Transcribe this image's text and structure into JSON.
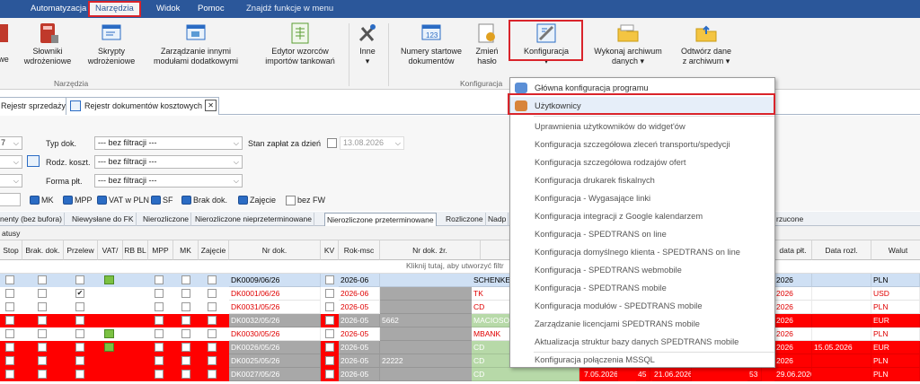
{
  "menubar": {
    "items": [
      {
        "label": "Automatyzacja"
      },
      {
        "label": "Narzędzia"
      },
      {
        "label": "Widok"
      },
      {
        "label": "Pomoc"
      }
    ],
    "search": "Znajdź funkcje w menu"
  },
  "ribbon": {
    "buttons": [
      {
        "label": "we",
        "icon": "rules-icon"
      },
      {
        "label": "Słowniki\nwdrożeniowe",
        "icon": "book-icon"
      },
      {
        "label": "Skrypty\nwdrożeniowe",
        "icon": "script-icon"
      },
      {
        "label": "Zarządzanie innymi\nmodułami dodatkowymi",
        "icon": "modules-icon"
      },
      {
        "label": "Edytor wzorców\nimportów tankowań",
        "icon": "import-template-icon"
      },
      {
        "label": "Inne\n▾",
        "icon": "tools-icon"
      },
      {
        "label": "Numery startowe\ndokumentów",
        "icon": "numbers-icon"
      },
      {
        "label": "Zmień\nhasło",
        "icon": "password-icon"
      },
      {
        "label": "Konfiguracja\n▾",
        "icon": "configuration-icon"
      },
      {
        "label": "Wykonaj archiwum\ndanych ▾",
        "icon": "archive-icon"
      },
      {
        "label": "Odtwórz dane\nz archiwum ▾",
        "icon": "restore-icon"
      }
    ],
    "groups": {
      "tools": "Narzędzia",
      "config": "Konfiguracja"
    }
  },
  "doc_tabs": {
    "sales": "Rejestr sprzedaży",
    "costs": "Rejestr dokumentów kosztowych",
    "close": "✕"
  },
  "filters": {
    "year_fragment": "7",
    "typ_dok_label": "Typ dok.",
    "typ_dok_value": "--- bez filtracji ---",
    "rodz_label": "Rodz. koszt.",
    "rodz_value": "--- bez filtracji ---",
    "forma_label": "Forma płt.",
    "forma_value": "--- bez filtracji ---",
    "stan_label": "Stan zapłat za dzień",
    "stan_date": "13.08.2026",
    "flags": [
      "MK",
      "MPP",
      "VAT w PLN",
      "SF",
      "Brak dok.",
      "Zajęcie",
      "bez FW"
    ]
  },
  "subtabs": [
    "nenty (bez bufora)",
    "Niewysłane do FK",
    "Nierozliczone",
    "Nierozliczone nieprzeterminowane",
    "Nierozliczone przeterminowane",
    "Rozliczone",
    "Nadp",
    "rzucone"
  ],
  "status_text": "atusy",
  "grid": {
    "headers": [
      "Stop",
      "Brak. dok.",
      "Przelew",
      "VAT/",
      "RB BL",
      "MPP",
      "MK",
      "Zajęcie",
      "Nr dok.",
      "KV",
      "Rok-msc",
      "Nr dok. źr.",
      "Na",
      "data płt.",
      "Data rozl.",
      "Walut"
    ],
    "new_row_hint": "Kliknij tutaj, aby utworzyć filtr",
    "rows": [
      {
        "nr": "DK0009/06/26",
        "rok": "2026-06",
        "zr": "",
        "na": "SCHENKE",
        "data_plt": "2026",
        "data_rozl": "",
        "waluta": "PLN",
        "style": "selected",
        "przelew": false,
        "vat": true
      },
      {
        "nr": "DK0001/06/26",
        "rok": "2026-06",
        "zr": "",
        "na": "TK",
        "data_plt": "2026",
        "data_rozl": "",
        "waluta": "USD",
        "style": "white-red",
        "przelew": true,
        "vat": false
      },
      {
        "nr": "DK0031/05/26",
        "rok": "2026-05",
        "zr": "",
        "na": "CD",
        "data_plt": "2026",
        "data_rozl": "",
        "waluta": "PLN",
        "style": "white-red",
        "przelew": false,
        "vat": false
      },
      {
        "nr": "DK0032/05/26",
        "rok": "2026-05",
        "zr": "5662",
        "na": "MACIOSO",
        "data_plt": "2026",
        "data_rozl": "",
        "waluta": "EUR",
        "style": "red",
        "przelew": false,
        "vat": false
      },
      {
        "nr": "DK0030/05/26",
        "rok": "2026-05",
        "zr": "",
        "na": "MBANK",
        "data_plt": "2026",
        "data_rozl": "",
        "waluta": "PLN",
        "style": "white-red",
        "przelew": false,
        "vat": true
      },
      {
        "nr": "DK0026/05/26",
        "rok": "2026-05",
        "zr": "",
        "na": "CD",
        "data_plt": "2026",
        "data_rozl": "15.05.2026",
        "waluta": "EUR",
        "style": "red",
        "przelew": false,
        "vat": true
      },
      {
        "nr": "DK0025/05/26",
        "rok": "2026-05",
        "zr": "22222",
        "na": "CD",
        "data_plt": "2026",
        "data_rozl": "",
        "waluta": "PLN",
        "style": "red",
        "przelew": false,
        "vat": false
      },
      {
        "nr": "DK0027/05/26",
        "rok": "2026-05",
        "zr": "",
        "na": "CD",
        "data_plt": "29.06.2026",
        "data_rozl": "",
        "waluta": "PLN",
        "style": "red",
        "przelew": false,
        "vat": false,
        "extra": [
          "7.05.2026",
          "45",
          "21.06.2026",
          "53"
        ]
      }
    ]
  },
  "dropdown": {
    "items": [
      {
        "label": "Główna konfiguracja programu",
        "icon": "main-config-icon",
        "enabled": true
      },
      {
        "label": "Użytkownicy",
        "icon": "users-icon",
        "enabled": true,
        "highlighted": true
      },
      {
        "label": "Uprawnienia użytkowników do widget'ów",
        "enabled": false
      },
      {
        "label": "Konfiguracja szczegółowa zleceń transportu/spedycji",
        "enabled": false
      },
      {
        "label": "Konfiguracja szczegółowa rodzajów ofert",
        "enabled": false
      },
      {
        "label": "Konfiguracja drukarek fiskalnych",
        "enabled": false
      },
      {
        "label": "Konfiguracja - Wygasające linki",
        "enabled": false
      },
      {
        "label": "Konfiguracja integracji z Google kalendarzem",
        "enabled": false
      },
      {
        "label": "Konfiguracja - SPEDTRANS on line",
        "enabled": false
      },
      {
        "label": "Konfiguracja domyślnego klienta - SPEDTRANS on line",
        "enabled": false
      },
      {
        "label": "Konfiguracja - SPEDTRANS webmobile",
        "enabled": false
      },
      {
        "label": "Konfiguracja - SPEDTRANS mobile",
        "enabled": false
      },
      {
        "label": "Konfiguracja modułów - SPEDTRANS mobile",
        "enabled": false
      },
      {
        "label": "Zarządzanie licencjami SPEDTRANS mobile",
        "enabled": false
      },
      {
        "label": "Aktualizacja struktur bazy danych SPEDTRANS mobile",
        "enabled": false
      },
      {
        "label": "Konfiguracja połączenia MSSQL",
        "enabled": false
      }
    ]
  },
  "colors": {
    "brand": "#2b579a",
    "highlight": "#d9242b",
    "row_red": "#ff0000",
    "selected": "#cfe0f4"
  }
}
